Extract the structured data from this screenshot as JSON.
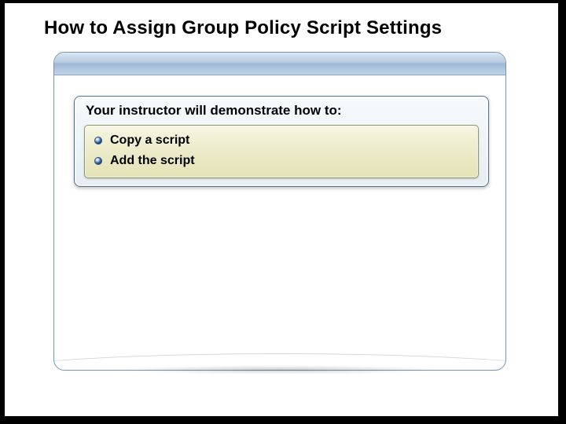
{
  "title": "How to Assign Group Policy Script Settings",
  "callout": {
    "heading": "Your instructor will demonstrate how to:",
    "tasks": [
      {
        "label": "Copy a script"
      },
      {
        "label": "Add the script"
      }
    ]
  }
}
